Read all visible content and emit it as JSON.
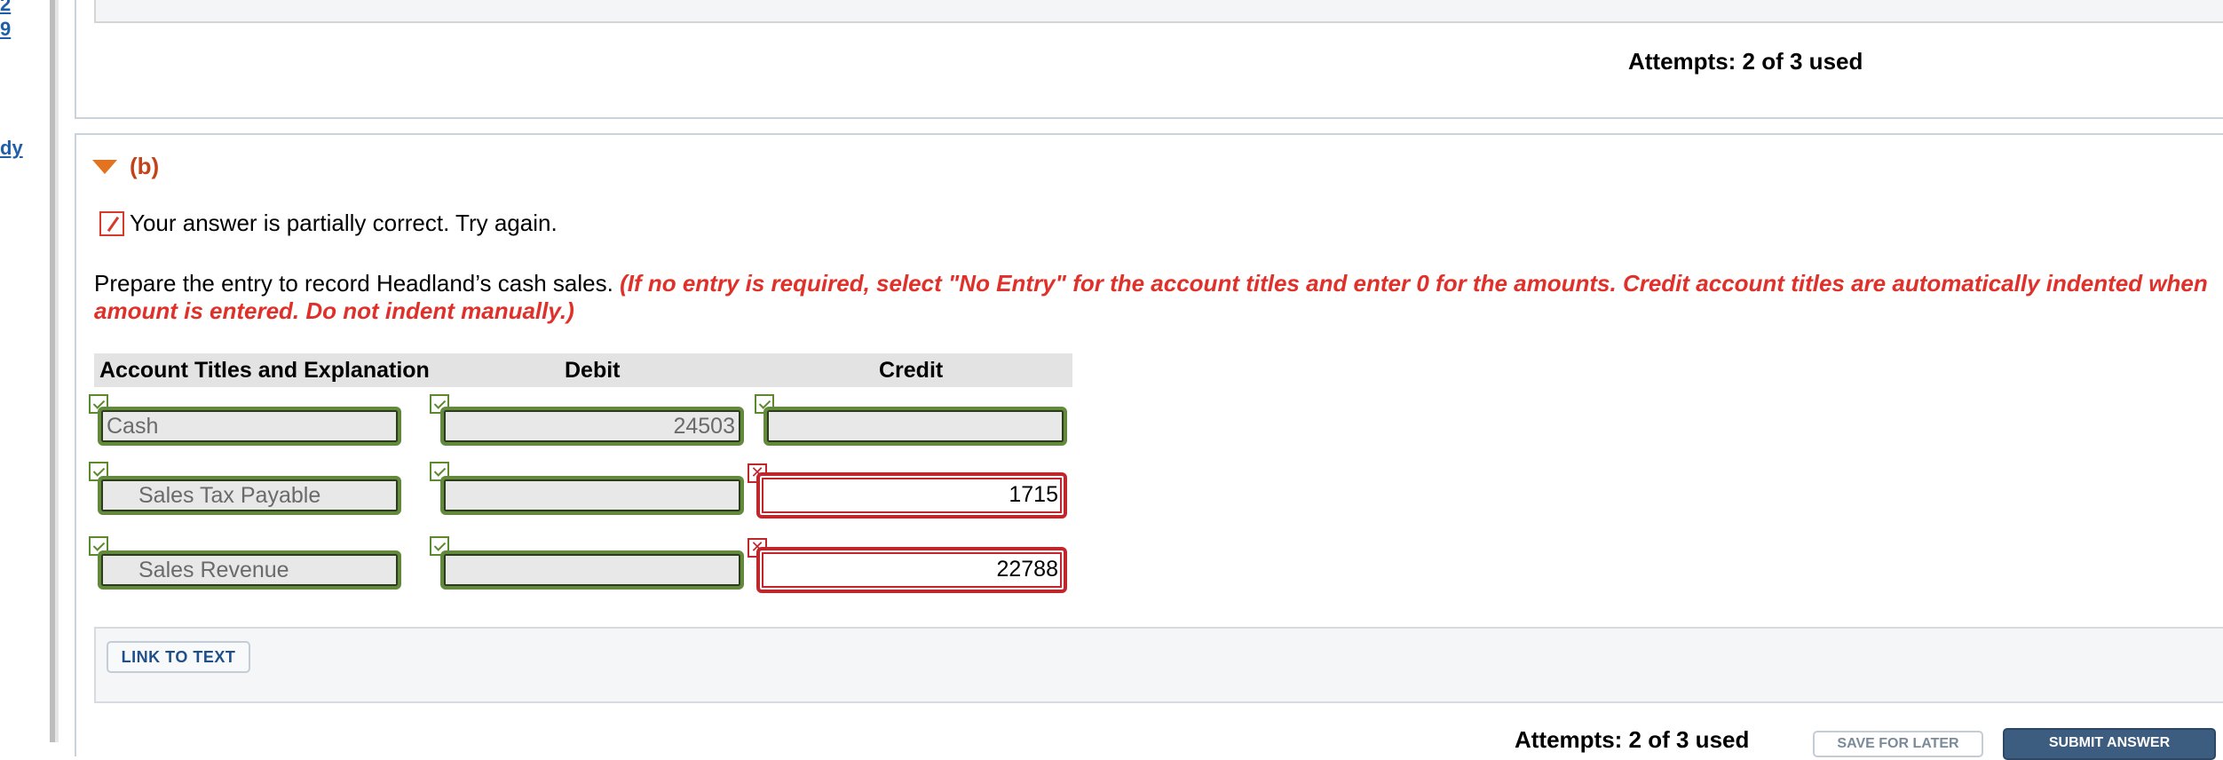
{
  "left_links": [
    "2",
    "9",
    "dy"
  ],
  "top_panel": {
    "attempts": "Attempts: 2 of 3 used"
  },
  "part": {
    "label": "(b)"
  },
  "feedback": {
    "status_text": "Your answer is partially correct.  Try again."
  },
  "question": {
    "prompt": "Prepare the entry to record Headland’s cash sales.",
    "instructions": "(If no entry is required, select \"No Entry\" for the account titles and enter 0 for the amounts. Credit account titles are automatically indented when amount is entered. Do not indent manually.)"
  },
  "journal": {
    "headers": {
      "account": "Account Titles and Explanation",
      "debit": "Debit",
      "credit": "Credit"
    },
    "rows": [
      {
        "account": "Cash",
        "debit": "24503",
        "credit": "",
        "account_status": "correct",
        "debit_status": "correct",
        "credit_status": "correct"
      },
      {
        "account": "Sales Tax Payable",
        "debit": "",
        "credit": "1715",
        "account_status": "correct",
        "debit_status": "correct",
        "credit_status": "incorrect"
      },
      {
        "account": "Sales Revenue",
        "debit": "",
        "credit": "22788",
        "account_status": "correct",
        "debit_status": "correct",
        "credit_status": "incorrect"
      }
    ]
  },
  "link_to_text_label": "LINK TO TEXT",
  "footer": {
    "attempts": "Attempts: 2 of 3 used",
    "save_label": "SAVE FOR LATER",
    "submit_label": "SUBMIT ANSWER"
  },
  "icons": {
    "correct": "check-icon",
    "incorrect": "x-icon",
    "status": "pencil-icon",
    "toggle": "triangle-down-icon"
  },
  "colors": {
    "correct": "#63893d",
    "incorrect": "#c0272d",
    "instruction": "#e0302a",
    "part_label": "#c2431a"
  }
}
